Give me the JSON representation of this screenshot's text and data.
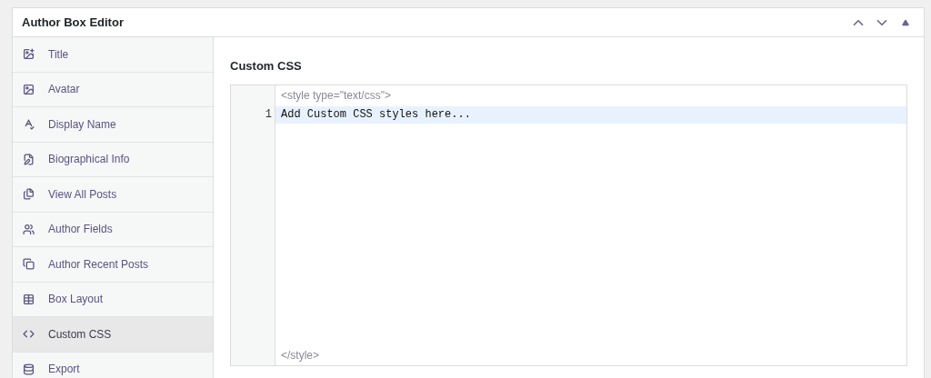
{
  "panel": {
    "title": "Author Box Editor"
  },
  "sidebar": {
    "items": [
      {
        "label": "Title",
        "selected": false
      },
      {
        "label": "Avatar",
        "selected": false
      },
      {
        "label": "Display Name",
        "selected": false
      },
      {
        "label": "Biographical Info",
        "selected": false
      },
      {
        "label": "View All Posts",
        "selected": false
      },
      {
        "label": "Author Fields",
        "selected": false
      },
      {
        "label": "Author Recent Posts",
        "selected": false
      },
      {
        "label": "Box Layout",
        "selected": false
      },
      {
        "label": "Custom CSS",
        "selected": true
      },
      {
        "label": "Export",
        "selected": false
      }
    ]
  },
  "content": {
    "heading": "Custom CSS",
    "editor": {
      "open_tag": "<style type=\"text/css\">",
      "lines": [
        {
          "number": "1",
          "text": "Add Custom CSS styles here...",
          "active": true
        }
      ],
      "close_tag": "</style>"
    }
  }
}
